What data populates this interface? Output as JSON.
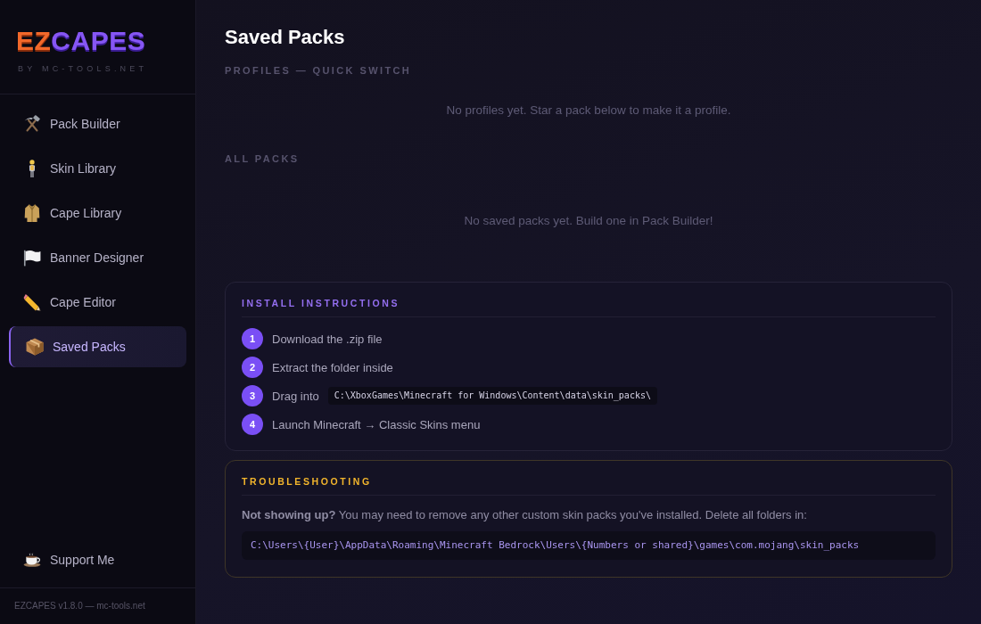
{
  "sidebar": {
    "logo": {
      "lead": "EZ",
      "rest": "CAPES"
    },
    "tagline": "BY MC-TOOLS.NET",
    "items": [
      {
        "label": "Pack Builder",
        "selected": false
      },
      {
        "label": "Skin Library",
        "selected": false
      },
      {
        "label": "Cape Library",
        "selected": false
      },
      {
        "label": "Banner Designer",
        "selected": false
      },
      {
        "label": "Cape Editor",
        "selected": false
      },
      {
        "label": "Saved Packs",
        "selected": true
      }
    ],
    "support": {
      "label": "Support Me"
    },
    "footer": "EZCAPES v1.8.0 — mc-tools.net"
  },
  "page": {
    "title": "Saved Packs",
    "sections": [
      {
        "heading": "PROFILES — QUICK SWITCH",
        "empty": "No profiles yet. Star a pack below to make it a profile."
      },
      {
        "heading": "ALL PACKS",
        "empty": "No saved packs yet. Build one in Pack Builder!"
      }
    ],
    "install": {
      "heading": "INSTALL INSTRUCTIONS",
      "steps": [
        {
          "number": "1",
          "text": "Download the .zip file"
        },
        {
          "number": "2",
          "text": "Extract the folder inside"
        },
        {
          "number": "3",
          "text": "Drag into",
          "code": "C:\\XboxGames\\Minecraft for Windows\\Content\\data\\skin_packs\\"
        },
        {
          "number": "4",
          "text": "Launch Minecraft → Classic Skins menu"
        }
      ]
    },
    "troubleshooting": {
      "heading": "TROUBLESHOOTING",
      "text": "**Not showing up?** You may need to remove any other custom skin packs you've installed. Delete all folders in:",
      "path": "C:\\Users\\{User}\\AppData\\Roaming\\Minecraft Bedrock\\Users\\{Numbers or shared}\\games\\com.mojang\\skin_packs"
    }
  }
}
